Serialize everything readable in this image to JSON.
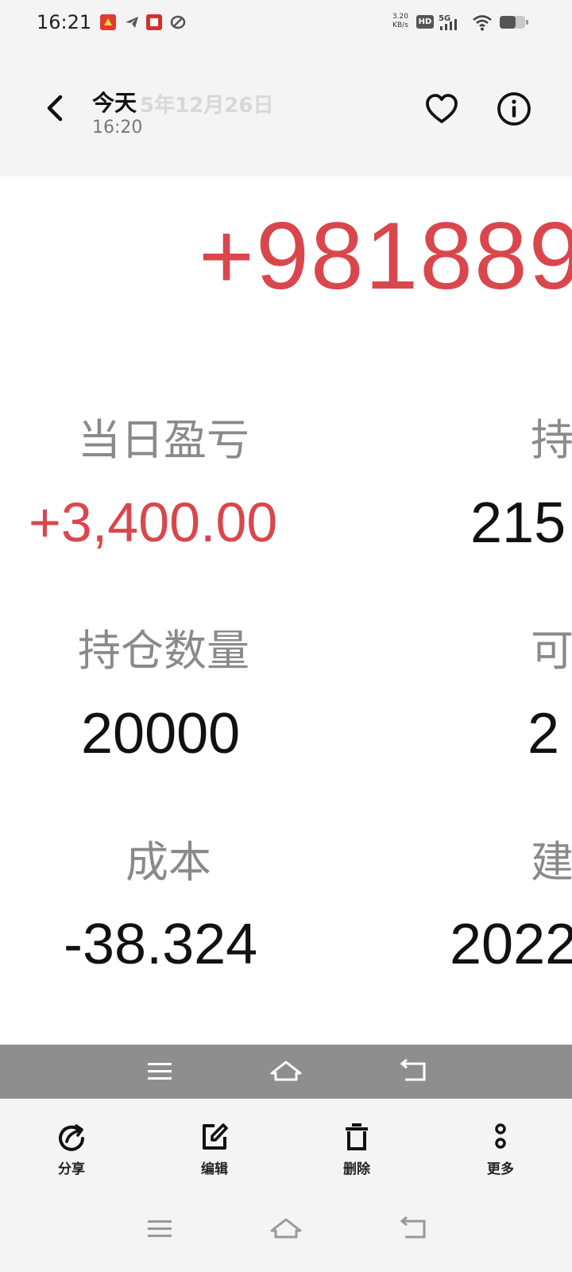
{
  "status_bar": {
    "time": "16:21",
    "net_speed_value": "3.20",
    "net_speed_unit": "KB/s",
    "hd_badge": "HD",
    "network": "5G"
  },
  "header": {
    "title": "今天",
    "ghost_date": "5年12月26日",
    "time": "16:20"
  },
  "photo": {
    "big_profit": "+981889",
    "daily_pl_label": "当日盈亏",
    "daily_pl_value": "+3,400.00",
    "holding_label_partial": "持",
    "holding_value_partial": "215",
    "qty_label": "持仓数量",
    "qty_value": "20000",
    "available_label_partial": "可",
    "available_value_partial": "2",
    "cost_label": "成本",
    "cost_value": "-38.324",
    "open_label_partial": "建",
    "open_value_partial": "2022"
  },
  "toolbar": {
    "share": "分享",
    "edit": "编辑",
    "delete": "删除",
    "more": "更多"
  },
  "colors": {
    "profit_red": "#d9474d",
    "background": "#f4f4f4",
    "nav_gray": "#8e8e8e"
  }
}
